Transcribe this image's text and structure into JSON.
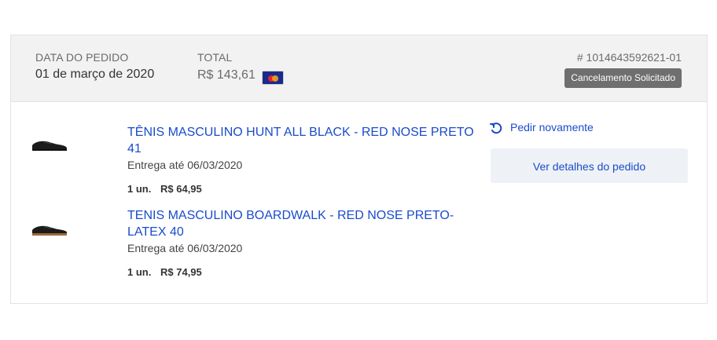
{
  "order": {
    "date_label": "DATA DO PEDIDO",
    "date_value": "01 de março de 2020",
    "total_label": "TOTAL",
    "total_value": "R$ 143,61",
    "payment_icon": "mastercard-icon",
    "order_number": "# 1014643592621-01",
    "status": "Cancelamento Solicitado"
  },
  "products": [
    {
      "title": "TÊNIS MASCULINO HUNT ALL BLACK - RED NOSE PRETO 41",
      "delivery": "Entrega até 06/03/2020",
      "qty": "1 un.",
      "price": "R$ 64,95",
      "image": "black-sneaker-image"
    },
    {
      "title": "TENIS MASCULINO BOARDWALK - RED NOSE PRETO-LATEX 40",
      "delivery": "Entrega até 06/03/2020",
      "qty": "1 un.",
      "price": "R$ 74,95",
      "image": "black-gum-sole-sneaker-image"
    }
  ],
  "actions": {
    "reorder_label": "Pedir novamente",
    "details_label": "Ver detalhes do pedido"
  },
  "colors": {
    "link": "#1a4cc9",
    "status_badge": "#6f6f6f",
    "header_bg": "#f2f2f2",
    "button_bg": "#eef2f6"
  }
}
